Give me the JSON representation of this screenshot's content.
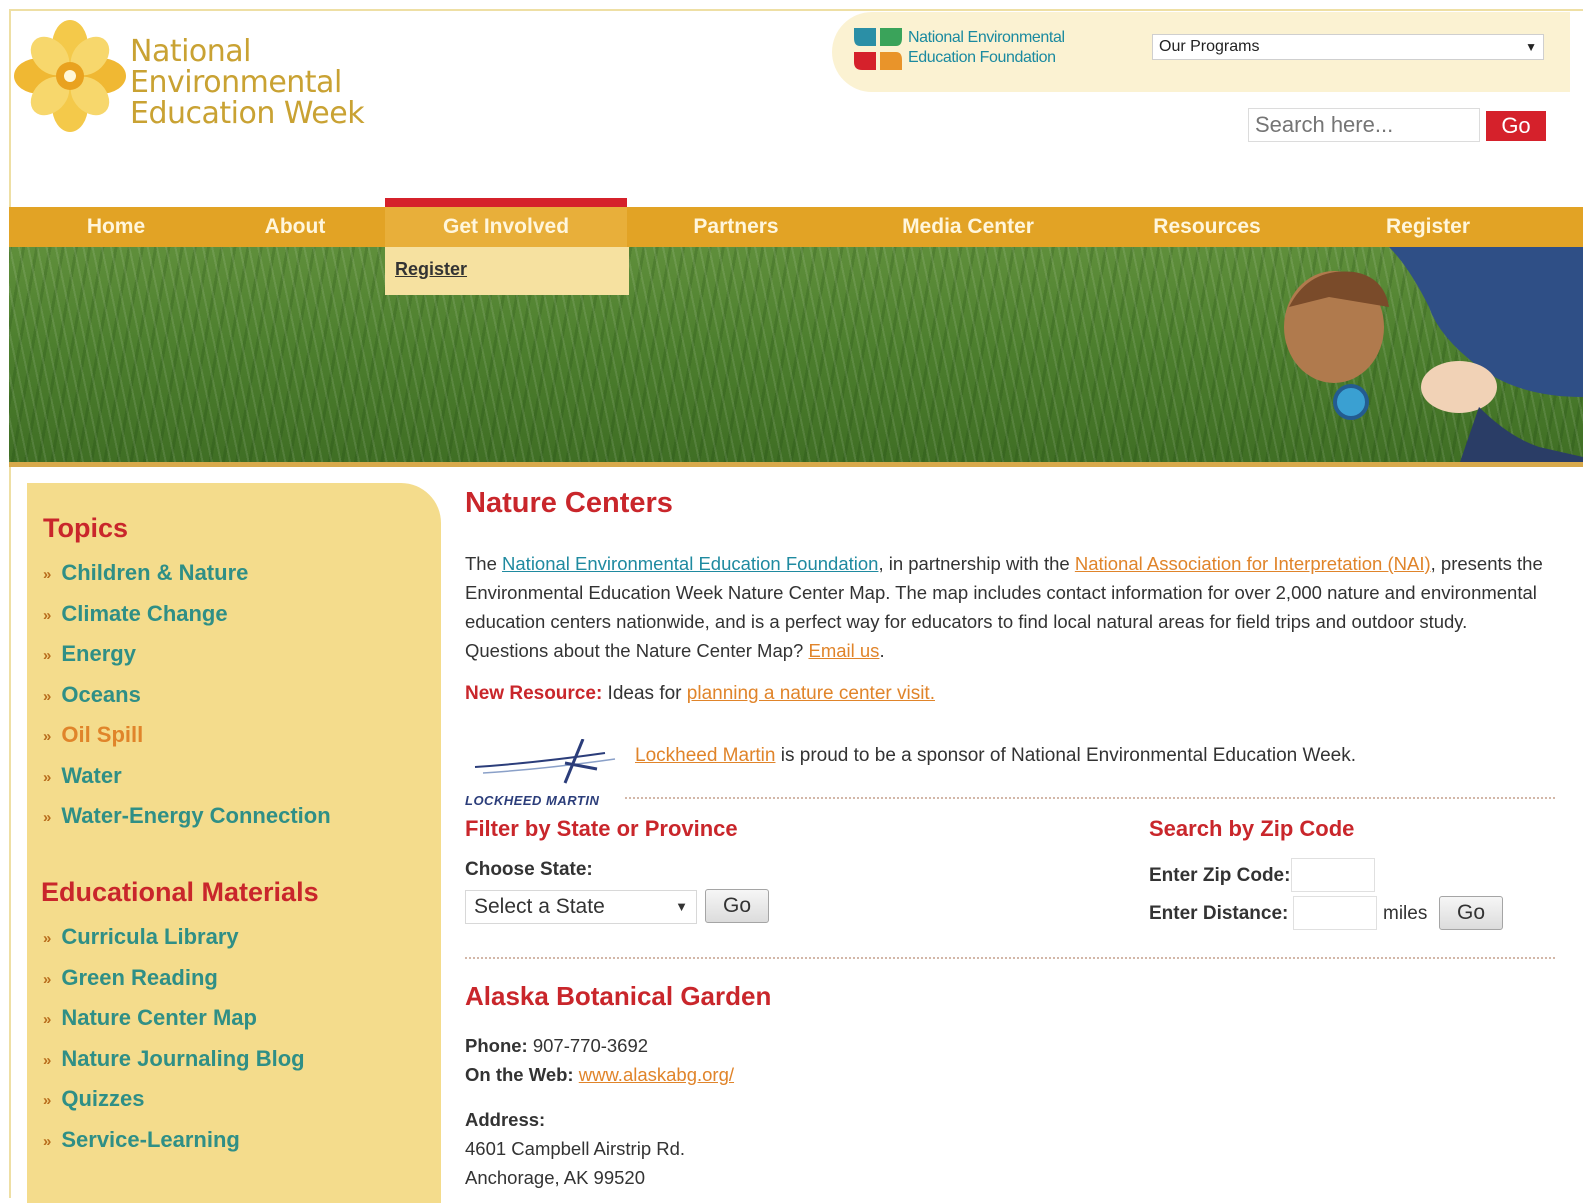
{
  "header": {
    "site_title_line1": "National Environmental",
    "site_title_line2": "Education Week",
    "neef_line1": "National Environmental",
    "neef_line2": "Education Foundation",
    "programs_select": "Our Programs",
    "search_placeholder": "Search here...",
    "search_go": "Go"
  },
  "nav": {
    "items": [
      "Home",
      "About",
      "Get Involved",
      "Partners",
      "Media Center",
      "Resources",
      "Register"
    ],
    "active": "Get Involved",
    "dropdown": [
      "Register"
    ]
  },
  "sidebar": {
    "topics_heading": "Topics",
    "topics": [
      "Children & Nature",
      "Climate Change",
      "Energy",
      "Oceans",
      "Oil Spill",
      "Water",
      "Water-Energy Connection"
    ],
    "materials_heading": "Educational Materials",
    "materials": [
      "Curricula Library",
      "Green Reading",
      "Nature Center Map",
      "Nature Journaling Blog",
      "Quizzes",
      "Service-Learning"
    ],
    "arrow": "»"
  },
  "main": {
    "title": "Nature Centers",
    "intro": {
      "t1": "The ",
      "link1": "National Environmental Education Foundation",
      "t2": ", in partnership with the ",
      "link2": "National Association for Interpretation (NAI)",
      "t3": ", presents the Environmental Education Week Nature Center Map. The map includes contact information for over 2,000 nature and environmental education centers nationwide, and is a perfect way for educators to find local natural areas for field trips and outdoor study. Questions about the Nature Center Map? ",
      "link3": "Email us",
      "t4": "."
    },
    "new_resource": {
      "label": "New Resource:",
      "text": " Ideas for ",
      "link": "planning a nature center visit."
    },
    "sponsor": {
      "logo_text": "LOCKHEED MARTIN",
      "link": "Lockheed Martin",
      "text": " is proud to be a sponsor of National Environmental Education Week."
    },
    "filter": {
      "title": "Filter by State or Province",
      "choose_label": "Choose State:",
      "select_value": "Select a State",
      "go": "Go"
    },
    "zip": {
      "title": "Search by Zip Code",
      "zip_label": "Enter Zip Code:",
      "distance_label": "Enter Distance:",
      "miles": "miles",
      "go": "Go"
    },
    "center": {
      "name": "Alaska Botanical Garden",
      "phone_label": "Phone:",
      "phone": " 907-770-3692",
      "web_label": "On the Web:",
      "web": "www.alaskabg.org/",
      "address_label": "Address:",
      "address1": "4601 Campbell Airstrip Rd.",
      "address2": "Anchorage, AK 99520"
    }
  },
  "colors": {
    "nav_bg": "#e2a325",
    "accent_red": "#d5212b",
    "sidebar_bg": "#f4dc8c",
    "link_teal": "#2f8f86",
    "link_orange": "#e0842a"
  }
}
